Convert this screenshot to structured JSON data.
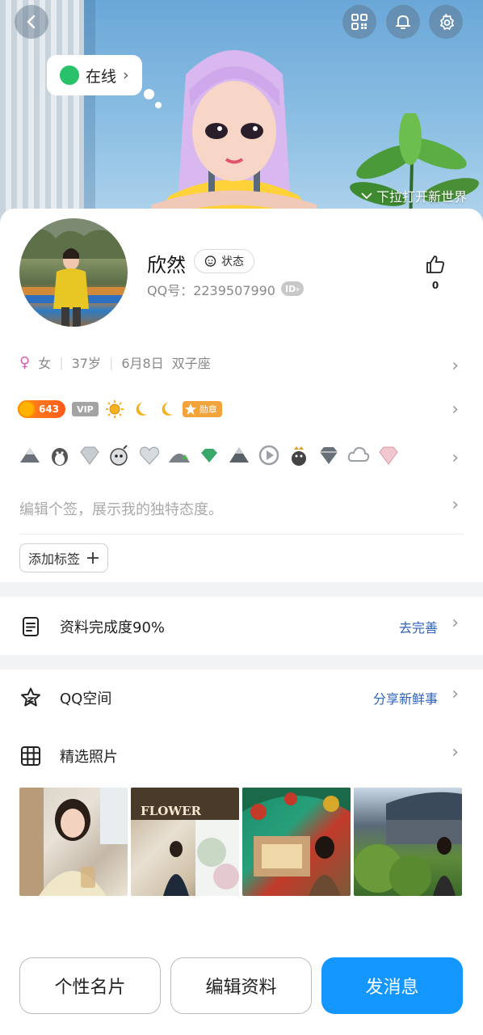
{
  "header": {
    "online_label": "在线",
    "pull_hint": "下拉打开新世界"
  },
  "profile": {
    "name": "欣然",
    "status_label": "状态",
    "qq_label": "QQ号：2239507990",
    "id_badge": "ID",
    "like_count": "0"
  },
  "info": {
    "gender": "女",
    "age": "37岁",
    "birthday": "6月8日",
    "zodiac": "双子座"
  },
  "badges": {
    "level": "643",
    "vip": "VIP",
    "medal": "勋章"
  },
  "signature_placeholder": "编辑个签，展示我的独特态度。",
  "add_tag_label": "添加标签",
  "profile_completion": {
    "label": "资料完成度90%",
    "action": "去完善"
  },
  "qzone": {
    "label": "QQ空间",
    "action": "分享新鲜事"
  },
  "photos": {
    "label": "精选照片",
    "shop_sign": "FLOWER"
  },
  "bottom_buttons": {
    "card": "个性名片",
    "edit": "编辑资料",
    "message": "发消息"
  },
  "colors": {
    "primary": "#1397ff",
    "online": "#29c26b",
    "link": "#2f63b8"
  }
}
